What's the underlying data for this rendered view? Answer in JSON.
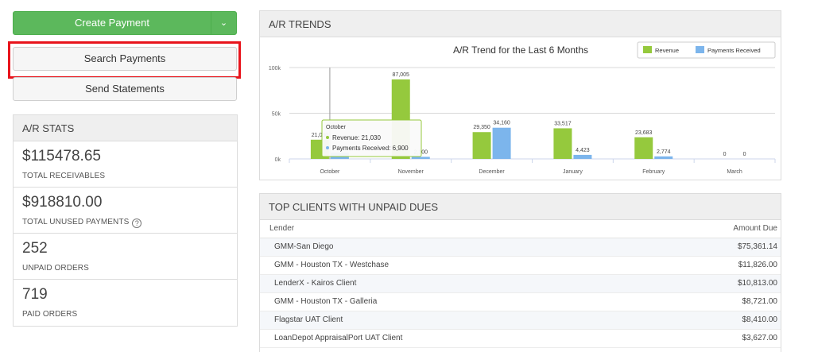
{
  "left": {
    "create_payment": "Create Payment",
    "search_payments": "Search Payments",
    "send_statements": "Send Statements"
  },
  "stats": {
    "title": "A/R STATS",
    "items": [
      {
        "value": "$115478.65",
        "label": "TOTAL RECEIVABLES"
      },
      {
        "value": "$918810.00",
        "label": "TOTAL UNUSED PAYMENTS"
      },
      {
        "value": "252",
        "label": "UNPAID ORDERS"
      },
      {
        "value": "719",
        "label": "PAID ORDERS"
      }
    ]
  },
  "trends": {
    "title": "A/R TRENDS"
  },
  "chart_data": {
    "type": "bar",
    "title": "A/R Trend for the Last 6 Months",
    "categories": [
      "October",
      "November",
      "December",
      "January",
      "February",
      "March"
    ],
    "series": [
      {
        "name": "Revenue",
        "color": "#95c93d",
        "values": [
          21030,
          87005,
          29350,
          33517,
          23683,
          0
        ],
        "labels": [
          "21,030",
          "87,005",
          "29,350",
          "33,517",
          "23,683",
          "0"
        ]
      },
      {
        "name": "Payments Received",
        "color": "#7cb5ec",
        "values": [
          6900,
          2300,
          34160,
          4423,
          2774,
          0
        ],
        "labels": [
          "6,900",
          "2,300",
          "34,160",
          "4,423",
          "2,774",
          "0"
        ]
      }
    ],
    "yticks": [
      "0k",
      "50k",
      "100k"
    ],
    "ylim": [
      0,
      100000
    ],
    "legend": "top-right",
    "tooltip": {
      "title": "October",
      "lines": [
        "Revenue: 21,030",
        "Payments Received: 6,900"
      ]
    }
  },
  "clients": {
    "title": "TOP CLIENTS WITH UNPAID DUES",
    "columns": [
      "Lender",
      "Amount Due"
    ],
    "rows": [
      {
        "lender": "GMM-San Diego",
        "amount": "$75,361.14"
      },
      {
        "lender": "GMM - Houston TX - Westchase",
        "amount": "$11,826.00"
      },
      {
        "lender": "LenderX - Kairos Client",
        "amount": "$10,813.00"
      },
      {
        "lender": "GMM - Houston TX - Galleria",
        "amount": "$8,721.00"
      },
      {
        "lender": "Flagstar UAT Client",
        "amount": "$8,410.00"
      },
      {
        "lender": "LoanDepot AppraisalPort UAT Client",
        "amount": "$3,627.00"
      }
    ]
  }
}
